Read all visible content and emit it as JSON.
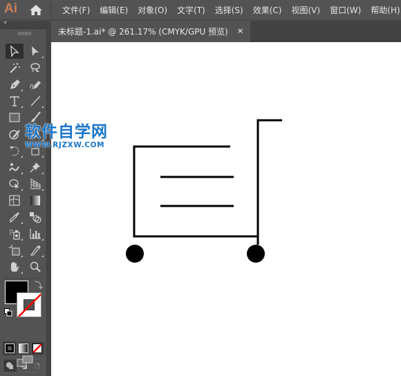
{
  "app": {
    "logo": "Ai",
    "brand_color": "#c9805a"
  },
  "menubar": {
    "items": [
      {
        "label": "文件(F)"
      },
      {
        "label": "编辑(E)"
      },
      {
        "label": "对象(O)"
      },
      {
        "label": "文字(T)"
      },
      {
        "label": "选择(S)"
      },
      {
        "label": "效果(C)"
      },
      {
        "label": "视图(V)"
      },
      {
        "label": "窗口(W)"
      },
      {
        "label": "帮助(H)"
      }
    ]
  },
  "panel": {
    "collapse_label": "‹‹"
  },
  "document_tab": {
    "title": "未标题-1.ai* @ 261.17% (CMYK/GPU 预览)",
    "close_label": "×"
  },
  "tools": [
    {
      "name": "selection-tool",
      "active": true
    },
    {
      "name": "direct-selection-tool"
    },
    {
      "name": "magic-wand-tool"
    },
    {
      "name": "lasso-tool"
    },
    {
      "name": "pen-tool"
    },
    {
      "name": "curvature-tool"
    },
    {
      "name": "type-tool"
    },
    {
      "name": "line-segment-tool"
    },
    {
      "name": "rectangle-tool"
    },
    {
      "name": "paintbrush-tool"
    },
    {
      "name": "shaper-tool"
    },
    {
      "name": "eraser-tool"
    },
    {
      "name": "rotate-tool"
    },
    {
      "name": "scale-tool"
    },
    {
      "name": "warp-tool"
    },
    {
      "name": "puppet-warp-tool"
    },
    {
      "name": "shape-builder-tool"
    },
    {
      "name": "perspective-grid-tool"
    },
    {
      "name": "mesh-tool"
    },
    {
      "name": "gradient-tool"
    },
    {
      "name": "eyedropper-tool"
    },
    {
      "name": "blend-tool"
    },
    {
      "name": "symbol-sprayer-tool"
    },
    {
      "name": "column-graph-tool"
    },
    {
      "name": "artboard-tool"
    },
    {
      "name": "slice-tool"
    },
    {
      "name": "hand-tool"
    },
    {
      "name": "zoom-tool"
    }
  ],
  "colors": {
    "fill": "#000000",
    "stroke": "none",
    "none_slash": "#ff0000"
  },
  "watermark": {
    "text": "软件自学网",
    "url": "WWW.RJZXW.COM",
    "color": "#1a76c9"
  },
  "artwork": {
    "description": "shopping-cart line drawing",
    "stroke_color": "#000000"
  }
}
